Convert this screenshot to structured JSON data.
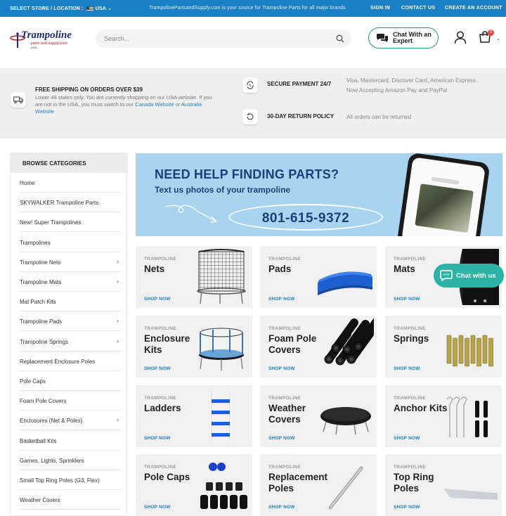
{
  "topbar": {
    "store_label": "SELECT STORE / LOCATION :",
    "store_value": "USA",
    "message": "TrampolinePartsandSupply.com is your source for Trampoline Parts for all major brands",
    "links": [
      "SIGN IN",
      "CONTACT US",
      "CREATE AN ACCOUNT"
    ]
  },
  "header": {
    "logo_main": "Trampoline",
    "logo_sub": "parts and supply.com",
    "logo_usa": "USA",
    "search_placeholder": "Search...",
    "chat_button": "Chat With an Expert",
    "cart_count": "0"
  },
  "info": {
    "shipping_title": "FREE SHIPPING ON ORDERS OVER $39",
    "shipping_text": "Lower 48 states only. You are currently shopping on our USA website. If you are not in the USA, you must switch to our",
    "shipping_link1": "Canada Website",
    "shipping_or": "or",
    "shipping_link2": "Australia Website",
    "payment_title": "SECURE PAYMENT 24/7",
    "payment_text1": "Visa, Mastercard, Discover Card, American Express.",
    "payment_text2": "Now Accepting Amazon Pay and PayPal",
    "return_title": "30-DAY RETURN POLICY",
    "return_text": "All orders can be returned"
  },
  "sidebar": {
    "title": "BROWSE CATEGORIES",
    "items": [
      {
        "label": "Home",
        "has_children": false
      },
      {
        "label": "SKYWALKER Trampoline Parts",
        "has_children": false
      },
      {
        "label": "New! Super Trampolines",
        "has_children": false
      },
      {
        "label": "Trampolines",
        "has_children": false
      },
      {
        "label": "Trampoline Nets",
        "has_children": true
      },
      {
        "label": "Trampoline Mats",
        "has_children": true
      },
      {
        "label": "Mat Patch Kits",
        "has_children": false
      },
      {
        "label": "Trampoline Pads",
        "has_children": true
      },
      {
        "label": "Trampoline Springs",
        "has_children": true
      },
      {
        "label": "Replacement Enclosure Poles",
        "has_children": false
      },
      {
        "label": "Pole Caps",
        "has_children": false
      },
      {
        "label": "Foam Pole Covers",
        "has_children": false
      },
      {
        "label": "Enclosures (Net & Poles)",
        "has_children": true
      },
      {
        "label": "Basketball Kits",
        "has_children": false
      },
      {
        "label": "Games, Lights, Sprinklers",
        "has_children": false
      },
      {
        "label": "Small Top Ring Poles (G3, Flex)",
        "has_children": false
      },
      {
        "label": "Weather Covers",
        "has_children": false
      }
    ]
  },
  "banner": {
    "headline": "NEED HELP FINDING PARTS?",
    "subhead": "Text us photos of your trampoline",
    "phone": "801-615-9372"
  },
  "products": [
    {
      "category": "TRAMPOLINE",
      "name": "Nets",
      "cta": "SHOP NOW",
      "icon": "net-image"
    },
    {
      "category": "TRAMPOLINE",
      "name": "Pads",
      "cta": "SHOP NOW",
      "icon": "pad-image"
    },
    {
      "category": "TRAMPOLINE",
      "name": "Mats",
      "cta": "SHOP NOW",
      "icon": "mat-image"
    },
    {
      "category": "TRAMPOLINE",
      "name": "Enclosure Kits",
      "cta": "SHOP NOW",
      "icon": "enclosure-image"
    },
    {
      "category": "TRAMPOLINE",
      "name": "Foam Pole Covers",
      "cta": "SHOP NOW",
      "icon": "foam-image"
    },
    {
      "category": "TRAMPOLINE",
      "name": "Springs",
      "cta": "SHOP NOW",
      "icon": "springs-image"
    },
    {
      "category": "TRAMPOLINE",
      "name": "Ladders",
      "cta": "SHOP NOW",
      "icon": "ladder-image"
    },
    {
      "category": "TRAMPOLINE",
      "name": "Weather Covers",
      "cta": "SHOP NOW",
      "icon": "cover-image"
    },
    {
      "category": "TRAMPOLINE",
      "name": "Anchor Kits",
      "cta": "SHOP NOW",
      "icon": "anchor-image"
    },
    {
      "category": "TRAMPOLINE",
      "name": "Pole Caps",
      "cta": "SHOP NOW",
      "icon": "polecap-image"
    },
    {
      "category": "TRAMPOLINE",
      "name": "Replacement Poles",
      "cta": "SHOP NOW",
      "icon": "pole-image"
    },
    {
      "category": "TRAMPOLINE",
      "name": "Top Ring Poles",
      "cta": "SHOP NOW",
      "icon": "ringpole-image"
    }
  ],
  "float_chat": "Chat with us",
  "colors": {
    "brand_blue": "#1a7fc4",
    "navy": "#1b3f7a",
    "teal": "#2db3a6",
    "banner_bg": "#a8d4f0",
    "card_bg": "#f1f1f1"
  }
}
